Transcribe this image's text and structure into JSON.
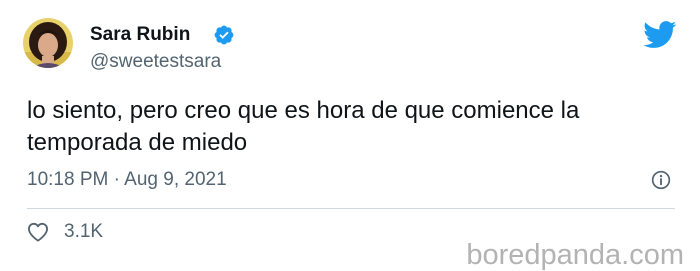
{
  "tweet": {
    "author": {
      "display_name": "Sara Rubin",
      "handle": "@sweetestsara",
      "verified": true,
      "avatar_icon": "avatar-photo"
    },
    "brand_icon": "twitter-bird-icon",
    "text": "lo siento, pero creo que es hora de que comience la temporada de miedo",
    "timestamp": "10:18 PM · Aug 9, 2021",
    "likes": "3.1K"
  },
  "watermark": {
    "text": "boredpanda.com"
  },
  "colors": {
    "text": "#0f1419",
    "secondary": "#536471",
    "twitter_blue": "#1d9bf0",
    "divider": "#cfd9de",
    "watermark": "#b3b3b3"
  }
}
